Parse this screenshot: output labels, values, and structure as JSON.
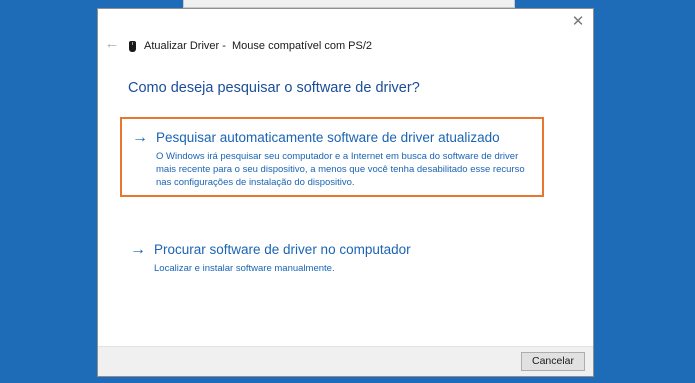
{
  "window": {
    "title": "Atualizar Driver -  Mouse compatível com PS/2",
    "close_icon": "close-icon",
    "back_icon": "back-arrow-icon",
    "device_icon": "mouse-icon"
  },
  "heading": "Como deseja pesquisar o software de driver?",
  "options": [
    {
      "arrow": "→",
      "title": "Pesquisar automaticamente software de driver atualizado",
      "description": "O Windows irá pesquisar seu computador e a Internet em busca do software de driver mais recente para o seu dispositivo, a menos que você tenha desabilitado esse recurso nas configurações de instalação do dispositivo."
    },
    {
      "arrow": "→",
      "title": "Procurar software de driver no computador",
      "description": "Localizar e instalar software manualmente."
    }
  ],
  "footer": {
    "cancel_label": "Cancelar"
  },
  "colors": {
    "desktop": "#1e6bb8",
    "link": "#1a64b4",
    "heading": "#1a4d99",
    "highlight": "#e9762e"
  }
}
